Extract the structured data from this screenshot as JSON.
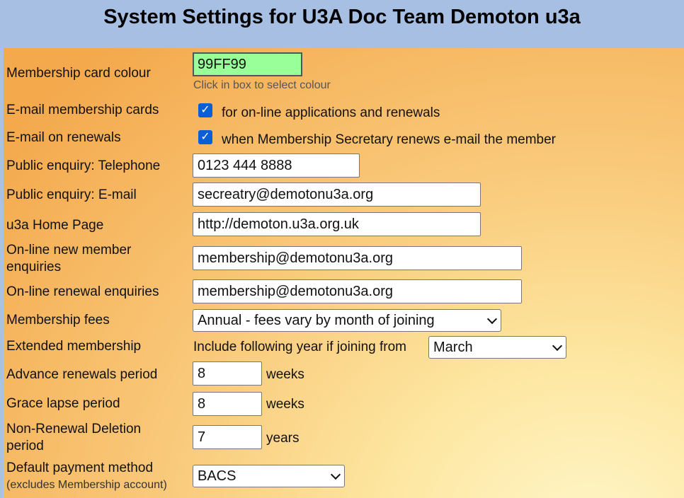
{
  "page": {
    "title": "System Settings for U3A Doc Team Demoton u3a"
  },
  "settings": {
    "card_colour": {
      "label": "Membership card colour",
      "value": "99FF99",
      "hint": "Click in box to select colour",
      "colour": "#99FF99"
    },
    "email_cards": {
      "label": "E-mail membership cards",
      "checked": true,
      "text": "for on-line applications and renewals"
    },
    "email_renewals": {
      "label": "E-mail on renewals",
      "checked": true,
      "text": "when Membership Secretary renews e-mail the member"
    },
    "public_phone": {
      "label": "Public enquiry: Telephone",
      "value": "0123 444 8888"
    },
    "public_email": {
      "label": "Public enquiry: E-mail",
      "value": "secreatry@demotonu3a.org"
    },
    "home_page": {
      "label": "u3a Home Page",
      "value": "http://demoton.u3a.org.uk"
    },
    "new_member": {
      "label_line1": "On-line new member",
      "label_line2": "enquiries",
      "value": "membership@demotonu3a.org"
    },
    "renewal_enquiries": {
      "label": "On-line renewal enquiries",
      "value": "membership@demotonu3a.org"
    },
    "fees": {
      "label": "Membership fees",
      "selected": "Annual - fees vary by month of joining"
    },
    "extended": {
      "label": "Extended membership",
      "text": "Include following year if joining from",
      "selected": "March"
    },
    "advance": {
      "label": "Advance renewals period",
      "value": "8",
      "unit": "weeks"
    },
    "grace": {
      "label": "Grace lapse period",
      "value": "8",
      "unit": "weeks"
    },
    "deletion": {
      "label_line1": "Non-Renewal Deletion",
      "label_line2": "period",
      "value": "7",
      "unit": "years"
    },
    "payment": {
      "label": "Default payment method",
      "sublabel": "(excludes Membership account)",
      "selected": "BACS"
    }
  },
  "icons": {
    "checkbox": "checkmark-icon",
    "select": "chevron-down-icon"
  }
}
